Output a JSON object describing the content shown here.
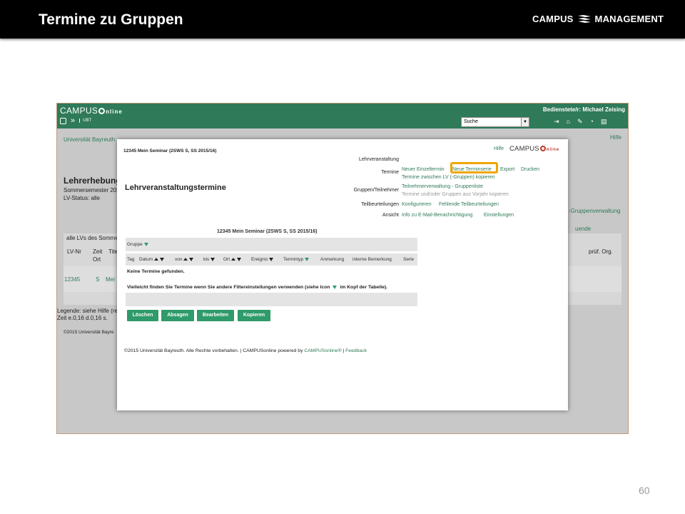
{
  "slide": {
    "title": "Termine zu Gruppen",
    "logo": {
      "left": "CAMPUS",
      "right": "MANAGEMENT"
    },
    "page_number": "60"
  },
  "campusonline": {
    "logo": {
      "word": "CAMPUS",
      "suffix": "nline",
      "sub": "UBT"
    },
    "user": "Bedienstete/r: Michael Zeising",
    "search_value": "Suche",
    "background": {
      "breadcrumb": "Universität Bayreuth",
      "hilfe": "Hilfe",
      "heading": "Lehrerhebung",
      "semester": "Sommersemester 201",
      "status": "LV-Status: alle",
      "lv_header": "alle LVs des Somme",
      "col_lvnr": "LV-Nr",
      "col_zeit": "Zeit",
      "col_ort": "Ort",
      "col_tite": "Tite",
      "col_pruef": "prüf. Org.",
      "row_nr": "12345",
      "row_s": "S",
      "row_mei": "Mei",
      "gruppen_link": "-Gruppenverwaltung",
      "uende_link": "uende",
      "legende": "Legende: siehe Hilfe (rec",
      "zeit": "Zeit e.0,16 d.0,16 s.",
      "copyright": "©2015 Universität Bayre"
    }
  },
  "popup": {
    "course": "12345 Mein Seminar (2SWS S, SS 2015/16)",
    "hilfe": "Hilfe",
    "logo": {
      "word": "CAMPUS",
      "suffix": "nline"
    },
    "title": "Lehrveranstaltungstermine",
    "menu": {
      "lehrveranstaltung": "Lehrveranstaltung",
      "termine_label": "Termine",
      "neuer_einzeltermin": "Neuer Einzeltermin",
      "neue_terminserie": "Neue Terminserie",
      "export": "Export",
      "drucken": "Drucken",
      "termine_kopieren": "Termine zwischen LV (-Gruppen) kopieren",
      "gruppen_label": "Gruppen/Teilnehmer",
      "teilnehmerverwaltung": "Teilnehmerverwaltung - Gruppenliste",
      "termine_vorjahr": "Termine und/oder Gruppen aus Vorjahr kopieren",
      "teilbeurteilungen_label": "Teilbeurteilungen",
      "konfigurieren": "Konfigurieren",
      "fehlende": "Fehlende Teilbeurteilungen",
      "ansicht_label": "Ansicht",
      "info_email": "Info zu E-Mail-Benachrichtigung",
      "einstellungen": "Einstellungen"
    },
    "table": {
      "caption": "12345 Mein Seminar (2SWS S, SS 2015/16)",
      "gruppe": "Gruppe",
      "columns": [
        "Tag",
        "Datum",
        "von",
        "bis",
        "Ort",
        "Ereignis",
        "Termintyp",
        "Anmerkung",
        "interne Bemerkung",
        "Serie"
      ],
      "no_entries": "Keine Termine gefunden.",
      "hint_before": "Vielleicht finden Sie Termine wenn Sie andere Filtereinstellungen verwenden (siehe Icon",
      "hint_after": "im Kopf der Tabelle)."
    },
    "buttons": {
      "loeschen": "Löschen",
      "absagen": "Absagen",
      "bearbeiten": "Bearbeiten",
      "kopieren": "Kopieren"
    },
    "footer": {
      "text": "©2015 Universität Bayreuth. Alle Rechte vorbehalten. | CAMPUSonline powered by",
      "link": "CAMPUSonline®",
      "sep": "|",
      "feedback": "Feedback"
    }
  }
}
